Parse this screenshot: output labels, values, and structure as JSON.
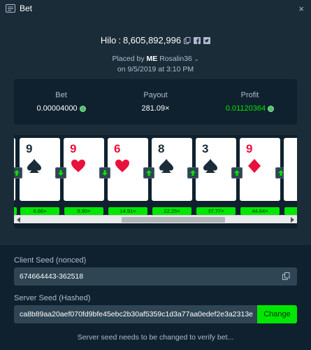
{
  "window": {
    "title": "Bet",
    "close_label": "×"
  },
  "bet": {
    "game": "Hilo",
    "separator": ":",
    "id": "8,605,892,996",
    "placed_prefix": "Placed by",
    "user": "ME",
    "username": "Rosalin36",
    "placed_on": "on 9/5/2019 at 3:10 PM"
  },
  "stats": {
    "bet_label": "Bet",
    "bet_value": "0.00004000",
    "payout_label": "Payout",
    "payout_value": "281.09×",
    "profit_label": "Profit",
    "profit_value": "0.01120364"
  },
  "cards": [
    {
      "rank": "9",
      "suit": "spade",
      "color": "black",
      "guess": "higher",
      "multiplier": "6.66×"
    },
    {
      "rank": "9",
      "suit": "heart",
      "color": "red",
      "guess": "lower",
      "multiplier": "9.90×"
    },
    {
      "rank": "6",
      "suit": "heart",
      "color": "red",
      "guess": "lower",
      "multiplier": "14.91×"
    },
    {
      "rank": "8",
      "suit": "spade",
      "color": "black",
      "guess": "higher",
      "multiplier": "22.25×"
    },
    {
      "rank": "3",
      "suit": "spade",
      "color": "black",
      "guess": "higher",
      "multiplier": "37.77×"
    },
    {
      "rank": "9",
      "suit": "diamond",
      "color": "red",
      "guess": "higher",
      "multiplier": "44.64×"
    }
  ],
  "seeds": {
    "client_label": "Client Seed (nonced)",
    "client_value": "674664443-362518",
    "server_label": "Server Seed (Hashed)",
    "server_value": "ca8b89aa20aef070fd9bfe45ebc2b30af5359c1d3a77aa0edef2e3a2313e",
    "change_label": "Change"
  },
  "note": "Server seed needs to be changed to verify bet...",
  "colors": {
    "accent": "#00e701",
    "background": "#1a2c38",
    "panel": "#0f212e",
    "input": "#2f4553",
    "red_suit": "#e9113c"
  }
}
